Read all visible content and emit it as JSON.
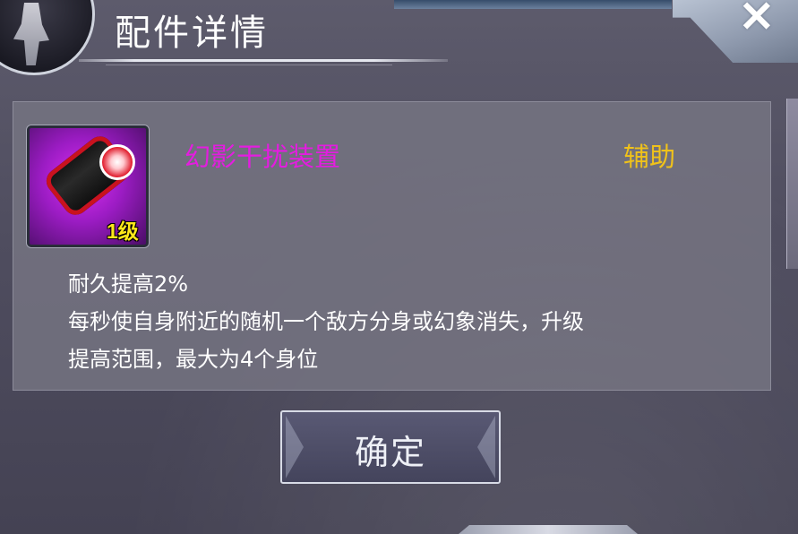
{
  "header": {
    "title": "配件详情",
    "close_icon": "close-icon"
  },
  "item": {
    "icon": "device-icon",
    "name": "幻影干扰装置",
    "name_color": "#e41ce0",
    "level": "1级",
    "category": "辅助",
    "category_color": "#f0c21a",
    "description_lines": [
      "耐久提高2%",
      "每秒使自身附近的随机一个敌方分身或幻象消失，升级",
      "提高范围，最大为4个身位"
    ]
  },
  "actions": {
    "confirm_label": "确定"
  }
}
